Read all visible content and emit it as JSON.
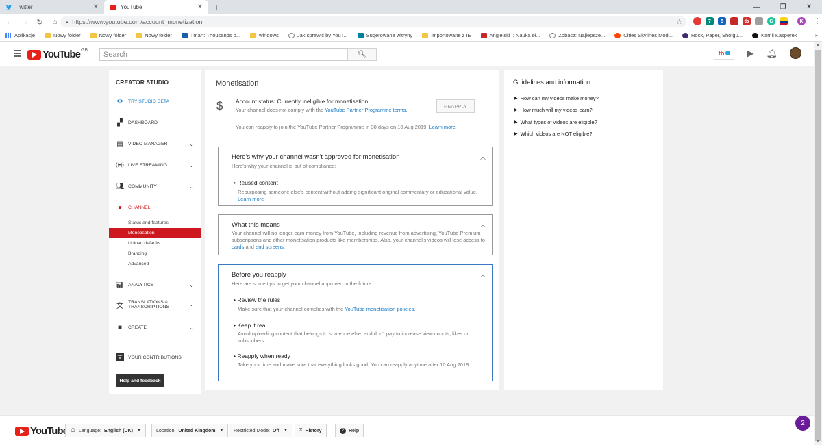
{
  "browser": {
    "tabs": [
      {
        "title": "Twitter",
        "active": false
      },
      {
        "title": "YouTube",
        "active": true
      }
    ],
    "url": "https://www.youtube.com/account_monetization",
    "extensions": [
      "7",
      "5",
      "tb",
      "G",
      "K"
    ],
    "bookmarks": [
      "Aplikacje",
      "Nowy folder",
      "Nowy folder",
      "Nowy folder",
      "Tmart: Thousands o...",
      "windows",
      "Jak sprawić by YouT...",
      "Sugerowane witryny",
      "Importowane z IE",
      "Angielski :: Nauka sł...",
      "Zobacz: Najlepsze...",
      "Cities Skylines Mod...",
      "Rock, Paper, Shotgu...",
      "Kamil Kasperek"
    ],
    "bookmarks_more": "»"
  },
  "header": {
    "logo_text": "YouTube",
    "country": "GB",
    "search_placeholder": "Search",
    "tb_badge": "tb"
  },
  "sidebar": {
    "title": "CREATOR STUDIO",
    "try_beta": "TRY STUDIO BETA",
    "dashboard": "DASHBOARD",
    "video_manager": "VIDEO MANAGER",
    "live_streaming": "LIVE STREAMING",
    "community": "COMMUNITY",
    "channel": "CHANNEL",
    "channel_subs": [
      "Status and features",
      "Monetisation",
      "Upload defaults",
      "Branding",
      "Advanced"
    ],
    "analytics": "ANALYTICS",
    "translations_1": "TRANSLATIONS &",
    "translations_2": "TRANSCRIPTIONS",
    "create": "CREATE",
    "contributions": "YOUR CONTRIBUTIONS",
    "help_button": "Help and feedback"
  },
  "main": {
    "title": "Monetisation",
    "account_status": "Account status: Currently ineligible for monetisation",
    "compliance_prefix": "Your channel does not comply with the ",
    "compliance_link": "YouTube Partner Programme terms.",
    "reapply_button": "REAPPLY",
    "reapply_note": "You can reapply to join the YouTube Partner Programme in 30 days on 10 Aug 2019.",
    "learn_more": "Learn more",
    "panel1": {
      "title": "Here's why your channel wasn't approved for monetisation",
      "subtitle": "Here's why your channel is out of compliance:",
      "bullet": "Reused content",
      "desc": "Repurposing someone else's content without adding significant original commentary or educational value.",
      "link": "Learn more"
    },
    "panel2": {
      "title": "What this means",
      "body": "Your channel will no longer earn money from YouTube, including revenue from advertising, YouTube Premium subscriptions and other monetisation products like memberships. Also, your channel's videos will lose access to",
      "link1": "cards",
      "and": "and",
      "link2": "end screens."
    },
    "panel3": {
      "title": "Before you reapply",
      "subtitle": "Here are some tips to get your channel approved in the future:",
      "tips": [
        {
          "title": "Review the rules",
          "desc": "Make sure that your channel complies with the ",
          "link": "YouTube monetisation policies."
        },
        {
          "title": "Keep it real",
          "desc": "Avoid uploading content that belongs to someone else, and don't pay to increase view counts, likes or subscribers.",
          "link": ""
        },
        {
          "title": "Reapply when ready",
          "desc": "Take your time and make sure that everything looks good. You can reapply anytime after 10 Aug 2019.",
          "link": ""
        }
      ]
    }
  },
  "guidelines": {
    "title": "Guidelines and information",
    "items": [
      "How can my videos make money?",
      "How much will my videos earn?",
      "What types of videos are eligible?",
      "Which videos are NOT eligible?"
    ]
  },
  "footer": {
    "logo_text": "YouTube",
    "language_label": "Language:",
    "language_value": "English (UK)",
    "location_label": "Location:",
    "location_value": "United Kingdom",
    "restricted_label": "Restricted Mode:",
    "restricted_value": "Off",
    "history": "History",
    "help": "Help",
    "notification_count": "2"
  }
}
